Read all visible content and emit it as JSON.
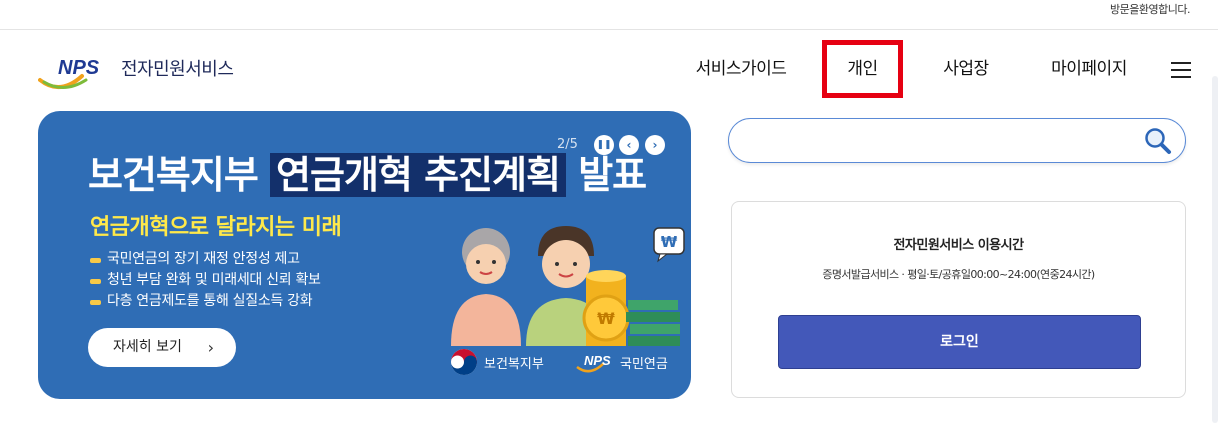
{
  "header": {
    "welcome_text": "방문을환영합니다.",
    "logo_text": "NPS",
    "service_name": "전자민원서비스"
  },
  "nav": {
    "items": [
      {
        "label": "서비스가이드"
      },
      {
        "label": "개인"
      },
      {
        "label": "사업장"
      },
      {
        "label": "마이페이지"
      }
    ],
    "highlight_color": "#e60012"
  },
  "banner": {
    "title_prefix": "보건복지부",
    "title_highlight": "연금개혁 추진계획",
    "title_suffix": "발표",
    "counter": "2/5",
    "subtitle": "연금개혁으로 달라지는 미래",
    "bullets": [
      "국민연금의 장기 재정 안정성 제고",
      "청년 부담 완화 및 미래세대 신뢰 확보",
      "다층 연금제도를 통해 실질소득 강화"
    ],
    "more_label": "자세히 보기",
    "logo_mohw": "보건복지부",
    "logo_nps_mark": "NPS",
    "logo_nps_text": "국민연금",
    "background_color": "#2f6db5",
    "subtitle_color": "#ffe94a"
  },
  "search": {
    "value": "",
    "placeholder": ""
  },
  "service_card": {
    "title": "전자민원서비스 이용시간",
    "hours": "증명서발급서비스 · 평일·토/공휴일00:00~24:00(연중24시간)",
    "login_label": "로그인",
    "button_color": "#4358b9"
  }
}
